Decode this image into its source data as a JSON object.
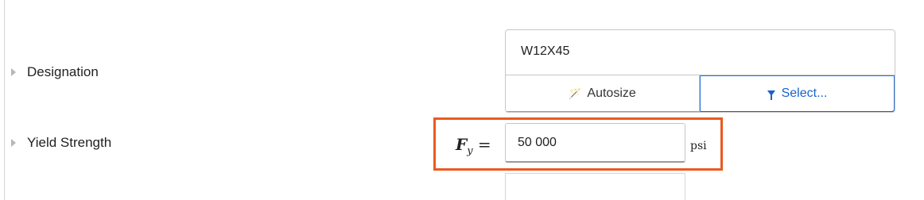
{
  "rows": {
    "designation": {
      "label": "Designation",
      "value": "W12X45",
      "autosize_label": "Autosize",
      "select_label": "Select..."
    },
    "yield_strength": {
      "label": "Yield Strength",
      "symbol": "F",
      "symbol_subscript": "y",
      "equals": "=",
      "value": "50 000",
      "unit": "psi"
    }
  },
  "colors": {
    "highlight": "#ea5a1f",
    "select_accent": "#1a62c9",
    "border": "#c7c7c7"
  },
  "icons": {
    "caret": "caret-right-icon",
    "autosize": "magic-wand-icon",
    "select": "filter-icon"
  }
}
